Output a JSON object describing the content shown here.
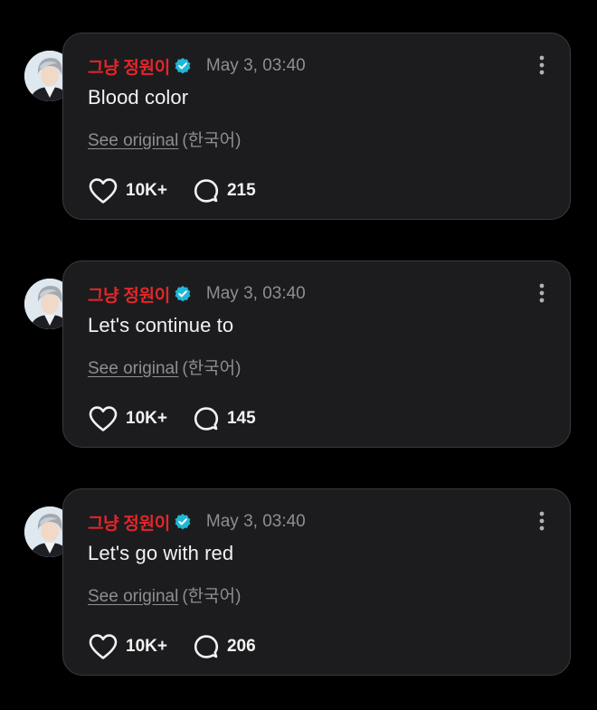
{
  "posts": [
    {
      "author": "그냥 정원이",
      "timestamp": "May 3, 03:40",
      "text": "Blood color",
      "see_original": "See original",
      "language": "(한국어)",
      "likes": "10K+",
      "replies": "215"
    },
    {
      "author": "그냥 정원이",
      "timestamp": "May 3, 03:40",
      "text": "Let's continue to",
      "see_original": "See original",
      "language": "(한국어)",
      "likes": "10K+",
      "replies": "145"
    },
    {
      "author": "그냥 정원이",
      "timestamp": "May 3, 03:40",
      "text": "Let's go with red",
      "see_original": "See original",
      "language": "(한국어)",
      "likes": "10K+",
      "replies": "206"
    }
  ],
  "colors": {
    "background": "#000000",
    "card": "#1c1c1e",
    "card_border": "#3a3a3c",
    "author": "#e2272b",
    "verified": "#1fb8d6",
    "muted": "#8e8e93",
    "text": "#f2f2f2"
  },
  "icons": {
    "verified": "verified-badge-icon",
    "more": "more-vertical-icon",
    "like": "heart-icon",
    "reply": "comment-bubble-icon",
    "avatar": "profile-avatar"
  }
}
